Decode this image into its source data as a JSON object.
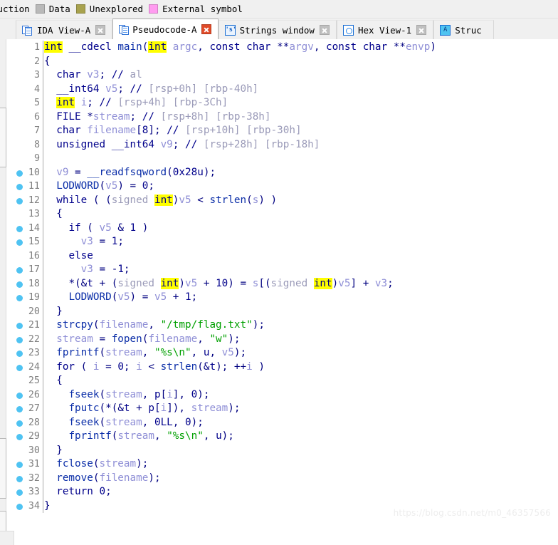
{
  "legend": {
    "items": [
      {
        "label": "ruction",
        "color": "",
        "swatch": false,
        "name": "legend-instruction"
      },
      {
        "label": "Data",
        "color": "#b9b9b9",
        "swatch": true,
        "name": "legend-data"
      },
      {
        "label": "Unexplored",
        "color": "#a8a24e",
        "swatch": true,
        "name": "legend-unexplored"
      },
      {
        "label": "External symbol",
        "color": "#ff9cf0",
        "swatch": true,
        "name": "legend-external-symbol"
      }
    ]
  },
  "tabs": [
    {
      "label": "IDA View-A",
      "icon": "document-icon",
      "active": false,
      "close": "gray",
      "name": "tab-ida-view-a"
    },
    {
      "label": "Pseudocode-A",
      "icon": "document-icon",
      "active": true,
      "close": "red",
      "name": "tab-pseudocode-a"
    },
    {
      "label": "Strings window",
      "icon": "strings-icon",
      "active": false,
      "close": "gray",
      "name": "tab-strings-window"
    },
    {
      "label": "Hex View-1",
      "icon": "hex-icon",
      "active": false,
      "close": "gray",
      "name": "tab-hex-view-1"
    },
    {
      "label": "Struc",
      "icon": "structures-icon",
      "active": false,
      "close": "none",
      "name": "tab-structures"
    }
  ],
  "watermark": "https://blog.csdn.net/m0_46357566",
  "colors": {
    "highlight": "#ffff00",
    "keyword": "#00008b",
    "string": "#00a000",
    "comment": "#8080a0",
    "local_var": "#8f8fd6",
    "breakpoint": "#4fc3f2",
    "line_number": "#808080"
  },
  "code": {
    "language": "c-pseudocode",
    "line_count": 34,
    "breakpoint_lines": [
      10,
      11,
      12,
      14,
      15,
      17,
      18,
      19,
      21,
      22,
      23,
      24,
      26,
      27,
      28,
      29,
      31,
      32,
      33,
      34
    ],
    "lines": [
      {
        "n": 1,
        "text": "int __cdecl main(int argc, const char **argv, const char **envp)",
        "tokens": [
          {
            "t": "int",
            "c": "hl"
          },
          {
            "t": " __cdecl ",
            "c": "kw"
          },
          {
            "t": "main",
            "c": "kw"
          },
          {
            "t": "(",
            "c": "punc"
          },
          {
            "t": "int",
            "c": "hl"
          },
          {
            "t": " argc, ",
            "c": "kw"
          },
          {
            "t": "const char ",
            "c": "kw"
          },
          {
            "t": "**argv, ",
            "c": "kw"
          },
          {
            "t": "const char ",
            "c": "kw"
          },
          {
            "t": "**envp)",
            "c": "kw"
          }
        ]
      },
      {
        "n": 2,
        "text": "{"
      },
      {
        "n": 3,
        "text": "  char v3; // al"
      },
      {
        "n": 4,
        "text": "  __int64 v5; // [rsp+0h] [rbp-40h]"
      },
      {
        "n": 5,
        "text": "  int i; // [rsp+4h] [rbp-3Ch]"
      },
      {
        "n": 6,
        "text": "  FILE *stream; // [rsp+8h] [rbp-38h]"
      },
      {
        "n": 7,
        "text": "  char filename[8]; // [rsp+10h] [rbp-30h]"
      },
      {
        "n": 8,
        "text": "  unsigned __int64 v9; // [rsp+28h] [rbp-18h]"
      },
      {
        "n": 9,
        "text": ""
      },
      {
        "n": 10,
        "text": "  v9 = __readfsqword(0x28u);"
      },
      {
        "n": 11,
        "text": "  LODWORD(v5) = 0;"
      },
      {
        "n": 12,
        "text": "  while ( (signed int)v5 < strlen(s) )"
      },
      {
        "n": 13,
        "text": "  {"
      },
      {
        "n": 14,
        "text": "    if ( v5 & 1 )"
      },
      {
        "n": 15,
        "text": "      v3 = 1;"
      },
      {
        "n": 16,
        "text": "    else"
      },
      {
        "n": 17,
        "text": "      v3 = -1;"
      },
      {
        "n": 18,
        "text": "    *(&t + (signed int)v5 + 10) = s[(signed int)v5] + v3;"
      },
      {
        "n": 19,
        "text": "    LODWORD(v5) = v5 + 1;"
      },
      {
        "n": 20,
        "text": "  }"
      },
      {
        "n": 21,
        "text": "  strcpy(filename, \"/tmp/flag.txt\");"
      },
      {
        "n": 22,
        "text": "  stream = fopen(filename, \"w\");"
      },
      {
        "n": 23,
        "text": "  fprintf(stream, \"%s\\n\", u, v5);"
      },
      {
        "n": 24,
        "text": "  for ( i = 0; i < strlen(&t); ++i )"
      },
      {
        "n": 25,
        "text": "  {"
      },
      {
        "n": 26,
        "text": "    fseek(stream, p[i], 0);"
      },
      {
        "n": 27,
        "text": "    fputc(*(&t + p[i]), stream);"
      },
      {
        "n": 28,
        "text": "    fseek(stream, 0LL, 0);"
      },
      {
        "n": 29,
        "text": "    fprintf(stream, \"%s\\n\", u);"
      },
      {
        "n": 30,
        "text": "  }"
      },
      {
        "n": 31,
        "text": "  fclose(stream);"
      },
      {
        "n": 32,
        "text": "  remove(filename);"
      },
      {
        "n": 33,
        "text": "  return 0;"
      },
      {
        "n": 34,
        "text": "}"
      }
    ]
  }
}
